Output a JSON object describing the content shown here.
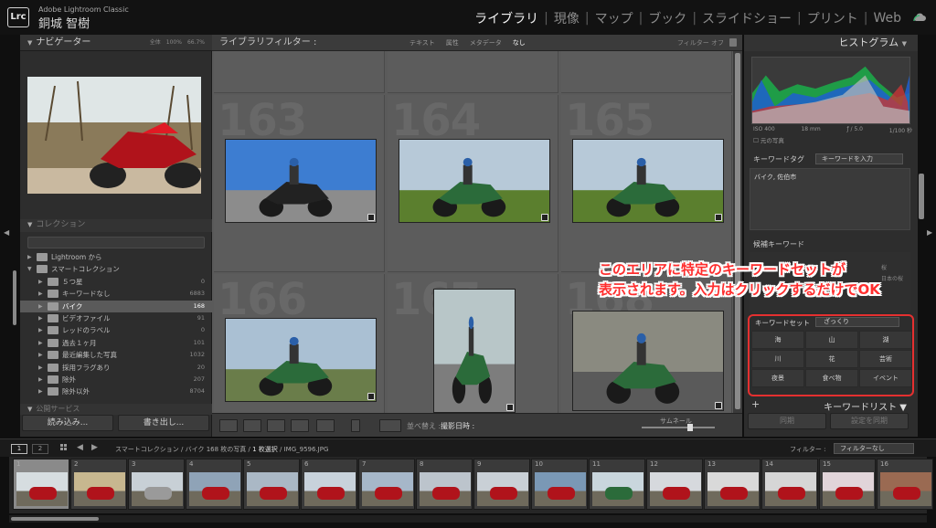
{
  "app": {
    "logo": "Lrc",
    "name": "Adobe Lightroom Classic",
    "user": "銅城 智樹"
  },
  "modules": [
    "ライブラリ",
    "現像",
    "マップ",
    "ブック",
    "スライドショー",
    "プリント",
    "Web"
  ],
  "active_module": "ライブラリ",
  "navigator": {
    "title": "ナビゲーター",
    "zoom_options": [
      "全体",
      "100%",
      "66.7%"
    ]
  },
  "collections": {
    "header": "コレクション",
    "items": [
      {
        "label": "Lightroom から",
        "count": "",
        "indent": 1,
        "expander": "▶"
      },
      {
        "label": "スマートコレクション",
        "count": "",
        "indent": 1,
        "expander": "▼"
      },
      {
        "label": "５つ星",
        "count": "0",
        "indent": 2
      },
      {
        "label": "キーワードなし",
        "count": "6883",
        "indent": 2
      },
      {
        "label": "バイク",
        "count": "168",
        "indent": 2,
        "selected": true
      },
      {
        "label": "ビデオファイル",
        "count": "91",
        "indent": 2
      },
      {
        "label": "レッドのラベル",
        "count": "0",
        "indent": 2
      },
      {
        "label": "過去１ヶ月",
        "count": "101",
        "indent": 2
      },
      {
        "label": "最近編集した写真",
        "count": "1032",
        "indent": 2
      },
      {
        "label": "採用フラグあり",
        "count": "20",
        "indent": 2
      },
      {
        "label": "除外",
        "count": "207",
        "indent": 2
      },
      {
        "label": "除外以外",
        "count": "8704",
        "indent": 2
      }
    ],
    "publish_header": "公開サービス"
  },
  "left_buttons": {
    "import": "読み込み...",
    "export": "書き出し..."
  },
  "filter_bar": {
    "title": "ライブラリフィルター :",
    "tabs": [
      "テキスト",
      "属性",
      "メタデータ",
      "なし"
    ],
    "active_tab": "なし",
    "right": "フィルター オフ"
  },
  "grid": {
    "cells": [
      {
        "num": "",
        "row": 0,
        "col": 0
      },
      {
        "num": "",
        "row": 0,
        "col": 1
      },
      {
        "num": "",
        "row": 0,
        "col": 2
      },
      {
        "num": "163",
        "row": 1,
        "col": 0
      },
      {
        "num": "164",
        "row": 1,
        "col": 1
      },
      {
        "num": "165",
        "row": 1,
        "col": 2
      },
      {
        "num": "166",
        "row": 2,
        "col": 0
      },
      {
        "num": "167",
        "row": 2,
        "col": 1
      },
      {
        "num": "168",
        "row": 2,
        "col": 2
      }
    ]
  },
  "toolbar": {
    "sort_label": "並べ替え :",
    "sort_value": "撮影日時 :",
    "thumb_label": "サムネール"
  },
  "right_panel": {
    "histogram_title": "ヒストグラム",
    "iso": "ISO 400",
    "focal": "18 mm",
    "aperture": "ƒ / 5.0",
    "shutter": "1/100 秒",
    "original_photo": "元の写真",
    "keyword_tag_label": "キーワードタグ",
    "keyword_tag_select": "キーワードを入力",
    "keyword_tag_value": "バイク, 佐伯市",
    "suggested_label": "候補キーワード",
    "suggested_side": [
      "桜",
      "日本の桜"
    ],
    "keyword_set_label": "キーワードセット",
    "keyword_set_select": "ざっくり",
    "keyword_set_buttons": [
      "海",
      "山",
      "湖",
      "川",
      "花",
      "芸術",
      "夜景",
      "食べ物",
      "イベント"
    ],
    "keyword_list_label": "キーワードリスト",
    "sync_metadata": "同期",
    "sync_settings": "設定を同期"
  },
  "annotation": {
    "line1": "このエリアに特定のキーワードセットが",
    "line2": "表示されます。入力はクリックするだけでOK"
  },
  "filmstrip_bar": {
    "pages": [
      "1",
      "2"
    ],
    "path_prefix": "スマートコレクション / バイク",
    "path_count": "168 枚の写真 /",
    "path_selected": "1 枚選択",
    "path_file": "/ IMG_9596.JPG",
    "filter_label": "フィルター :",
    "filter_value": "フィルターなし"
  },
  "filmstrip": [
    "1",
    "2",
    "3",
    "4",
    "5",
    "6",
    "7",
    "8",
    "9",
    "10",
    "11",
    "12",
    "13",
    "14",
    "15",
    "16"
  ],
  "colors": {
    "accent": "#e53030",
    "selected_row": "#5a5a5a"
  }
}
